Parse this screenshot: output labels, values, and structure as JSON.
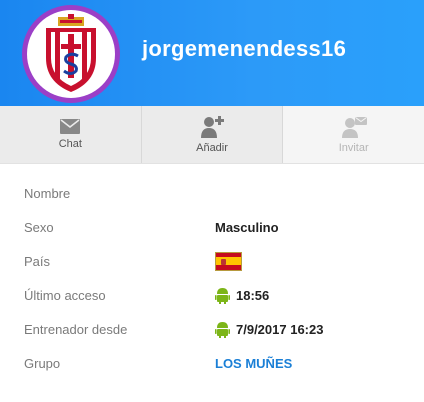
{
  "profile": {
    "username": "jorgemenendess16",
    "avatar_icon": "club-crest-icon"
  },
  "actions": [
    {
      "label": "Chat",
      "icon": "mail-icon",
      "enabled": true
    },
    {
      "label": "Añadir",
      "icon": "add-user-icon",
      "enabled": true
    },
    {
      "label": "Invitar",
      "icon": "invite-user-icon",
      "enabled": false
    }
  ],
  "info": {
    "nombre_label": "Nombre",
    "nombre_value": "",
    "sexo_label": "Sexo",
    "sexo_value": "Masculino",
    "pais_label": "País",
    "pais_flag": "spain-flag-icon",
    "ultimo_acceso_label": "Último acceso",
    "ultimo_acceso_value": "18:56",
    "entrenador_label": "Entrenador desde",
    "entrenador_value": "7/9/2017 16:23",
    "grupo_label": "Grupo",
    "grupo_value": "LOS MUÑES"
  },
  "colors": {
    "header": "#2a95f5",
    "avatar_ring": "#9b3fc7",
    "link": "#1a7fd6",
    "android": "#7cb518"
  }
}
